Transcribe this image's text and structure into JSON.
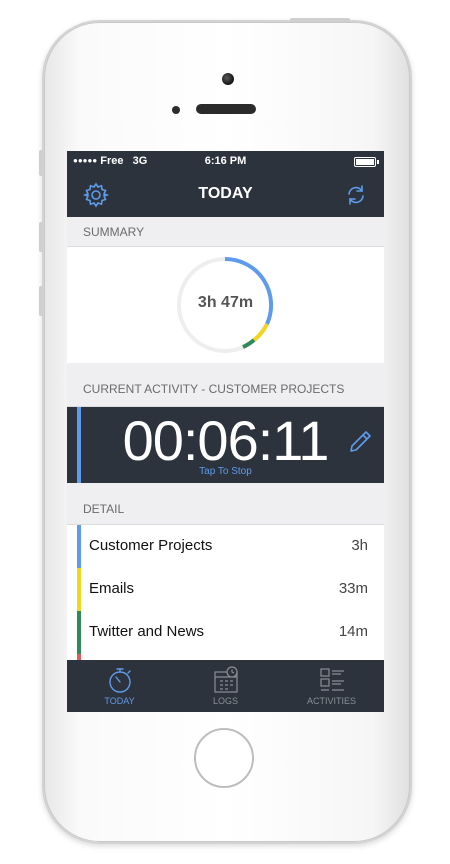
{
  "status_bar": {
    "carrier_dots": "●●●●●",
    "carrier": "Free",
    "network": "3G",
    "time": "6:16 PM"
  },
  "nav": {
    "title": "TODAY",
    "left_icon": "gear-icon",
    "right_icon": "refresh-icon"
  },
  "summary": {
    "header": "SUMMARY",
    "total": "3h 47m"
  },
  "current_activity": {
    "header": "CURRENT ACTIVITY - CUSTOMER PROJECTS",
    "timer": "00:06:11",
    "stop_label": "Tap To Stop",
    "edit_icon": "pencil-icon"
  },
  "detail": {
    "header": "DETAIL",
    "items": [
      {
        "name": "Customer Projects",
        "value": "3h",
        "color": "#5e9bea"
      },
      {
        "name": "Emails",
        "value": "33m",
        "color": "#f2d51f"
      },
      {
        "name": "Twitter and News",
        "value": "14m",
        "color": "#2e8b57"
      },
      {
        "name": "",
        "value": "",
        "color": "#e05a5a"
      }
    ]
  },
  "tabs": [
    {
      "label": "TODAY",
      "icon": "stopwatch-icon",
      "active": true
    },
    {
      "label": "LOGS",
      "icon": "calendar-clock-icon",
      "active": false
    },
    {
      "label": "ACTIVITIES",
      "icon": "activities-list-icon",
      "active": false
    }
  ],
  "colors": {
    "accent": "#5e9bea",
    "navbar": "#2d333d",
    "inactive_tab": "#8a8f96"
  }
}
